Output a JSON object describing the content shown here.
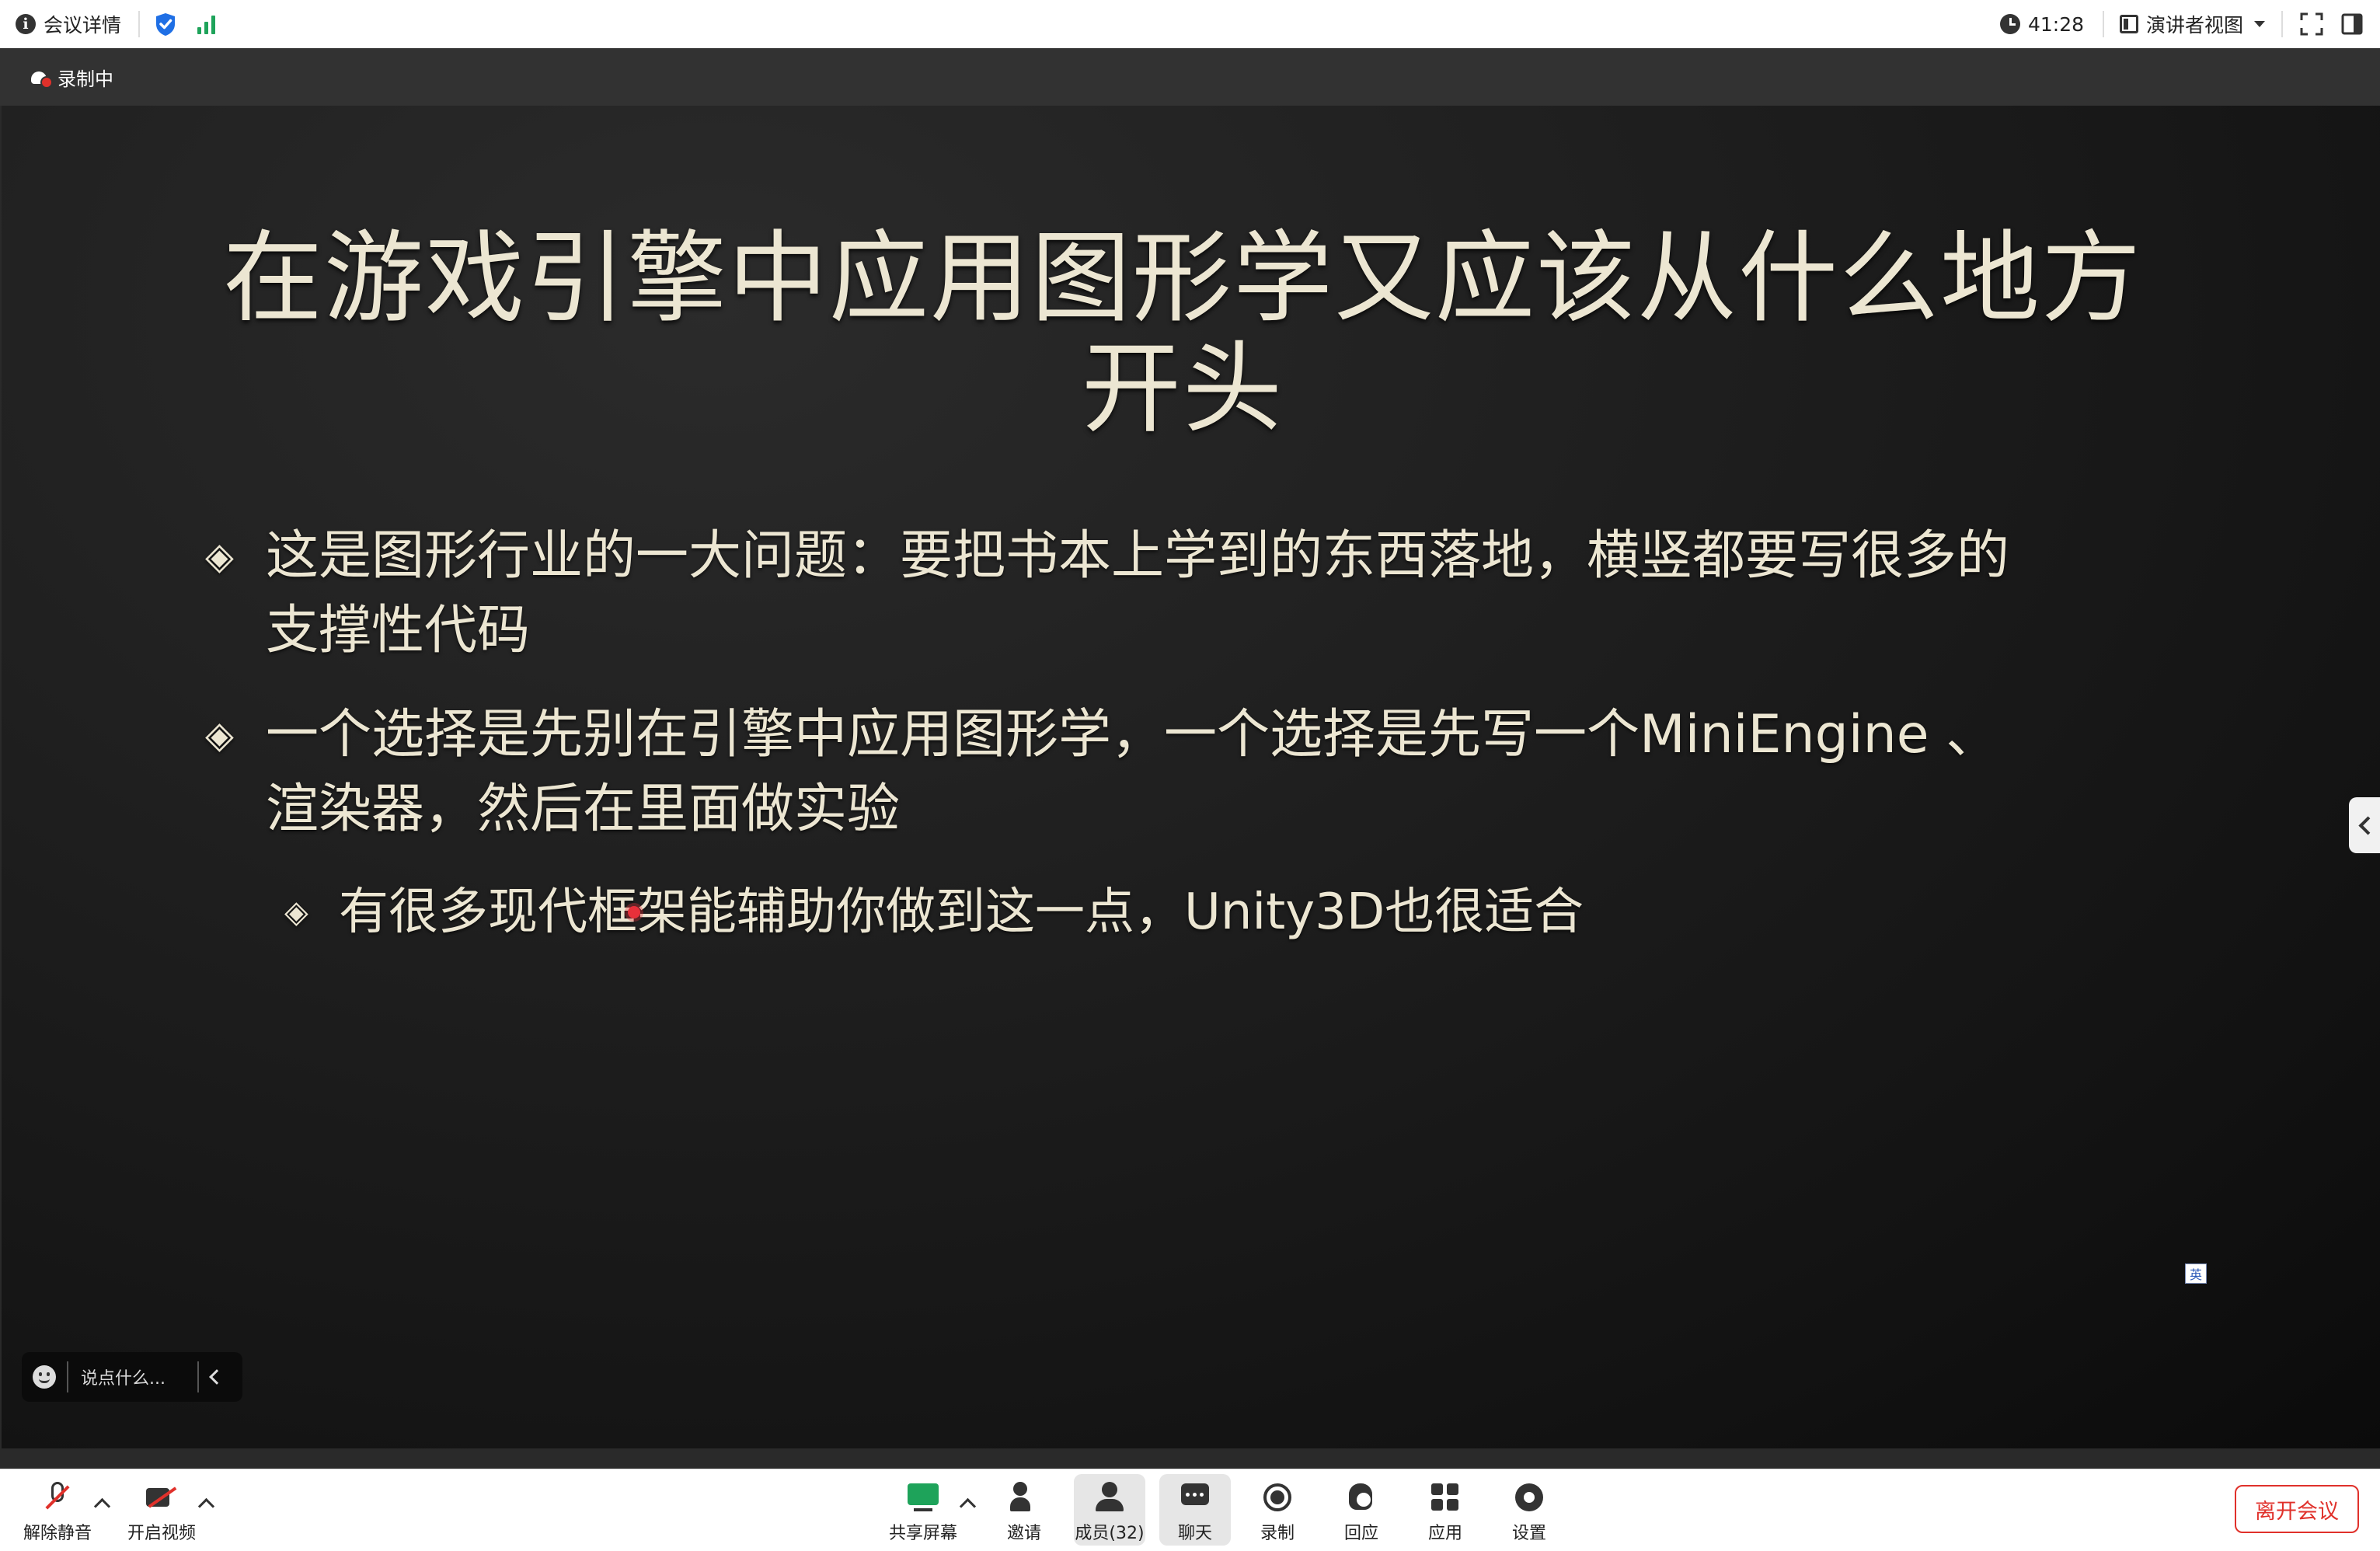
{
  "topbar": {
    "meeting_details_label": "会议详情",
    "timer": "41:28",
    "view_mode_label": "演讲者视图"
  },
  "stage": {
    "recording_label": "录制中",
    "chat_placeholder": "说点什么...",
    "language_badge": "英"
  },
  "slide": {
    "title_line1": "在游戏引擎中应用图形学又应该从什么地方",
    "title_line2": "开头",
    "bullets": [
      {
        "mark": "◈",
        "line1": "这是图形行业的一大问题：要把书本上学到的东西落地，横竖都要写很多的",
        "line2": "支撑性代码"
      },
      {
        "mark": "◈",
        "line1": "一个选择是先别在引擎中应用图形学，一个选择是先写一个MiniEngine 、",
        "line2": "渲染器，然后在里面做实验"
      },
      {
        "mark": "◈",
        "line1": "有很多现代框架能辅助你做到这一点，Unity3D也很适合"
      }
    ]
  },
  "toolbar": {
    "unmute": "解除静音",
    "start_video": "开启视频",
    "share_screen": "共享屏幕",
    "invite": "邀请",
    "members": "成员(32)",
    "chat": "聊天",
    "record": "录制",
    "react": "回应",
    "apps": "应用",
    "settings": "设置",
    "leave": "离开会议"
  },
  "colors": {
    "accent_green": "#1ea35a",
    "leave_red": "#e0312b",
    "slide_text": "#ece6d2",
    "shield_blue": "#1f6fe5"
  }
}
